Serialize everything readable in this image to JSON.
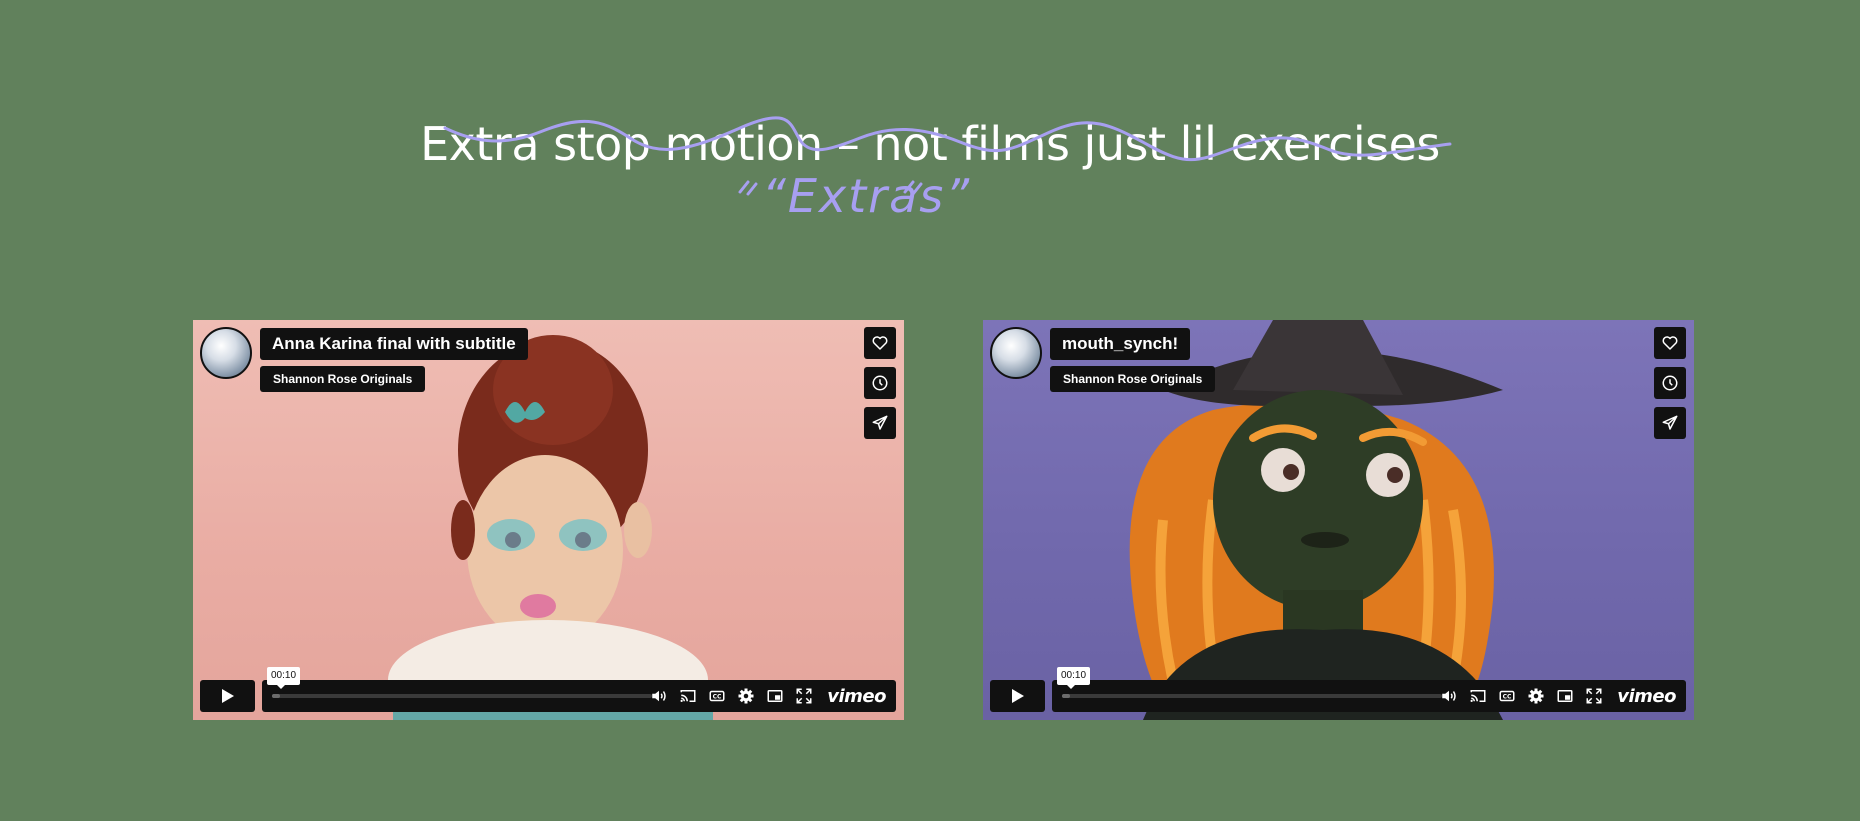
{
  "heading": {
    "title": "Extra stop motion – not films just lil exercises",
    "handwritten_note": "“Extras”",
    "scribble_color": "#a79ff0"
  },
  "videos": [
    {
      "title": "Anna Karina final with subtitle",
      "owner": "Shannon Rose Originals",
      "timestamp": "00:10",
      "brand": "vimeo",
      "progress": 0.02
    },
    {
      "title": "mouth_synch!",
      "owner": "Shannon Rose Originals",
      "timestamp": "00:10",
      "brand": "vimeo",
      "progress": 0.02
    }
  ],
  "icons": [
    "heart-icon",
    "clock-icon",
    "send-icon",
    "play-icon",
    "volume-icon",
    "cast-icon",
    "cc-icon",
    "gear-icon",
    "pip-icon",
    "fullscreen-icon"
  ],
  "colors": {
    "background": "#61815c",
    "player_ui": "#111111"
  }
}
